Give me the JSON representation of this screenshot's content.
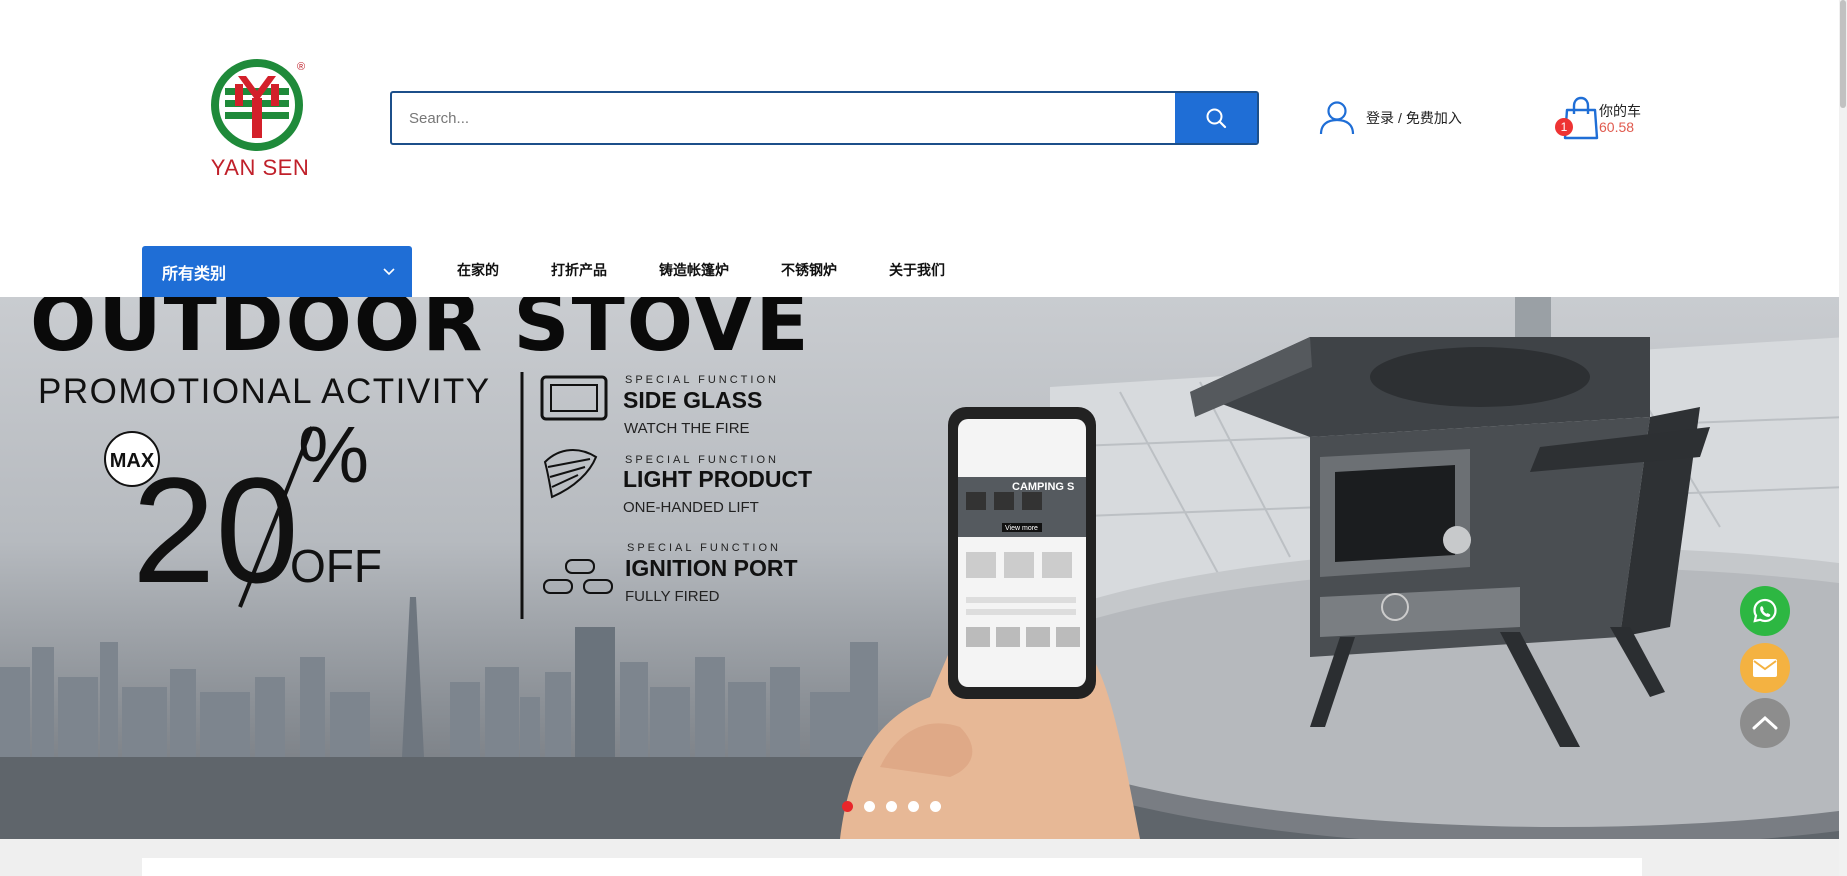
{
  "brand": {
    "name": "YAN SEN",
    "registered": "®"
  },
  "search": {
    "placeholder": "Search..."
  },
  "account": {
    "login": "登录",
    "separator": "/",
    "register": "免费加入"
  },
  "cart": {
    "count": "1",
    "title": "你的车",
    "amount": "60.58"
  },
  "category_button": {
    "label": "所有类别"
  },
  "nav": {
    "items": [
      "在家的",
      "打折产品",
      "铸造帐篷炉",
      "不锈钢炉",
      "关于我们"
    ]
  },
  "banner": {
    "headline": "OUTDOOR STOVE",
    "promo": "PROMOTIONAL ACTIVITY",
    "max_badge": "MAX",
    "discount_number": "20",
    "discount_percent": "%",
    "discount_suffix": "OFF",
    "features": [
      {
        "kicker": "SPECIAL FUNCTION",
        "title": "SIDE GLASS",
        "desc": "WATCH THE FIRE"
      },
      {
        "kicker": "SPECIAL FUNCTION",
        "title": "LIGHT PRODUCT",
        "desc": "ONE-HANDED LIFT"
      },
      {
        "kicker": "SPECIAL FUNCTION",
        "title": "IGNITION PORT",
        "desc": "FULLY FIRED"
      }
    ],
    "phone_screen": {
      "headline": "CAMPING S",
      "cta": "View more"
    },
    "active_slide": 1,
    "slide_count": 5
  },
  "colors": {
    "primary": "#1f6ed6",
    "search_border": "#1c4f8a",
    "logo_red": "#c0202a",
    "logo_green": "#1f8a3a",
    "dot_active": "#e8262a",
    "whatsapp": "#2db742",
    "mail": "#f4b241",
    "back_to_top": "#8d8d8d"
  },
  "icons": {
    "search": "search-icon",
    "user": "user-icon",
    "cart": "shopping-bag-icon",
    "dropdown": "chevron-down-icon",
    "whatsapp": "whatsapp-icon",
    "mail": "mail-icon",
    "top": "chevron-up-icon"
  }
}
